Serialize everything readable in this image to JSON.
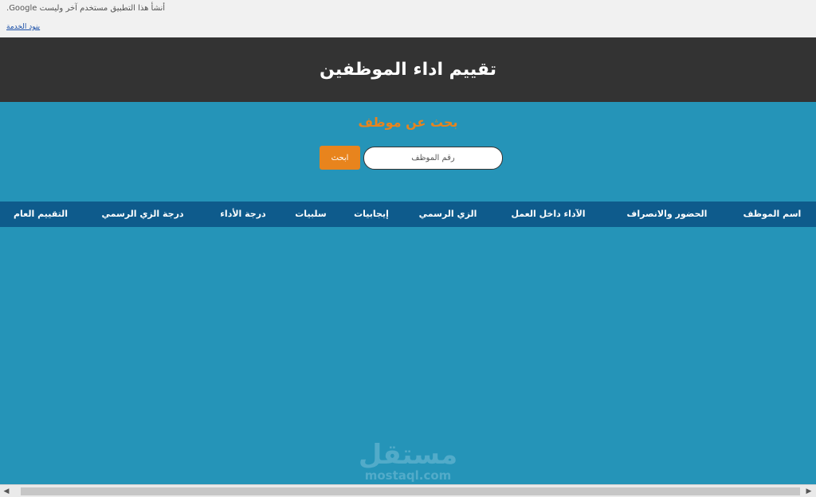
{
  "notice": {
    "text": "أنشأ هذا التطبيق مستخدم آخر وليست Google.",
    "link": "بنود الخدمة"
  },
  "header": {
    "title": "تقييم اداء الموظفين"
  },
  "search": {
    "title": "بحث عن موظف",
    "placeholder": "رقم الموظف",
    "button_label": "ابحث"
  },
  "table": {
    "columns": [
      "اسم الموظف",
      "الحضور والانصراف",
      "الآداء داخل العمل",
      "الزي الرسمي",
      "إيجابيات",
      "سلبيات",
      "درجة الأداء",
      "درجة الزي الرسمي",
      "التقييم العام"
    ]
  },
  "watermark": {
    "logo": "مستقل",
    "sub": "mostaql.com"
  },
  "scrollbar": {
    "left_icon": "scroll-left-icon",
    "right_icon": "scroll-right-icon"
  }
}
